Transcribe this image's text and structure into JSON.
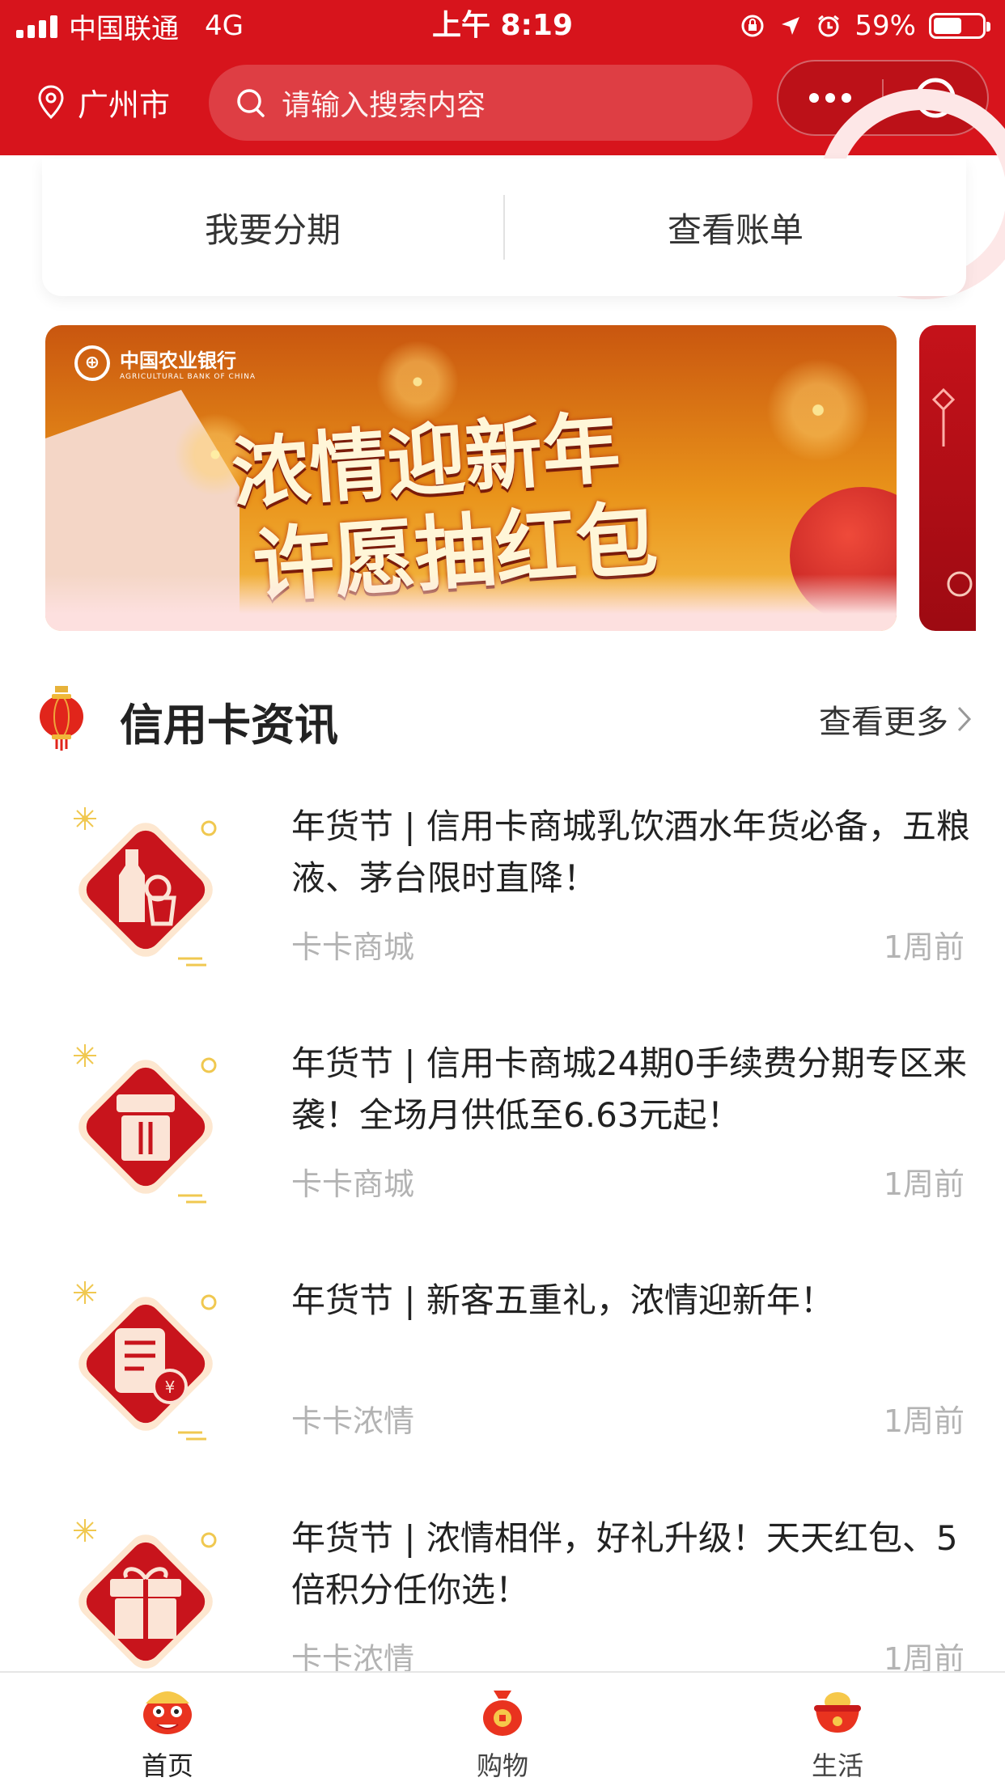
{
  "status_bar": {
    "carrier": "中国联通",
    "network": "4G",
    "time": "上午 8:19",
    "battery_percent": "59%",
    "battery_level": 0.59
  },
  "header": {
    "city": "广州市",
    "search_placeholder": "请输入搜索内容"
  },
  "actions": {
    "installment": "我要分期",
    "bill": "查看账单"
  },
  "banner": {
    "bank_name_cn": "中国农业银行",
    "bank_name_en": "AGRICULTURAL BANK OF CHINA",
    "line1": "浓情迎新年",
    "line2": "许愿抽红包"
  },
  "section": {
    "title": "信用卡资讯",
    "more": "查看更多"
  },
  "news": [
    {
      "headline": "年货节 | 信用卡商城乳饮酒水年货必备，五粮液、茅台限时直降！",
      "source": "卡卡商城",
      "time": "1周前",
      "icon": "bottle-drink-icon"
    },
    {
      "headline": "年货节 | 信用卡商城24期0手续费分期专区来袭！全场月供低至6.63元起！",
      "source": "卡卡商城",
      "time": "1周前",
      "icon": "gift-box-icon"
    },
    {
      "headline": "年货节 | 新客五重礼，浓情迎新年！",
      "source": "卡卡浓情",
      "time": "1周前",
      "icon": "document-money-bag-icon"
    },
    {
      "headline": "年货节 | 浓情相伴，好礼升级！天天红包、5倍积分任你选！",
      "source": "卡卡浓情",
      "time": "1周前",
      "icon": "present-icon"
    }
  ],
  "tabbar": {
    "home": "首页",
    "shopping": "购物",
    "life": "生活"
  },
  "colors": {
    "brand_red": "#d7141c",
    "muted_text": "#b3b3b3"
  }
}
